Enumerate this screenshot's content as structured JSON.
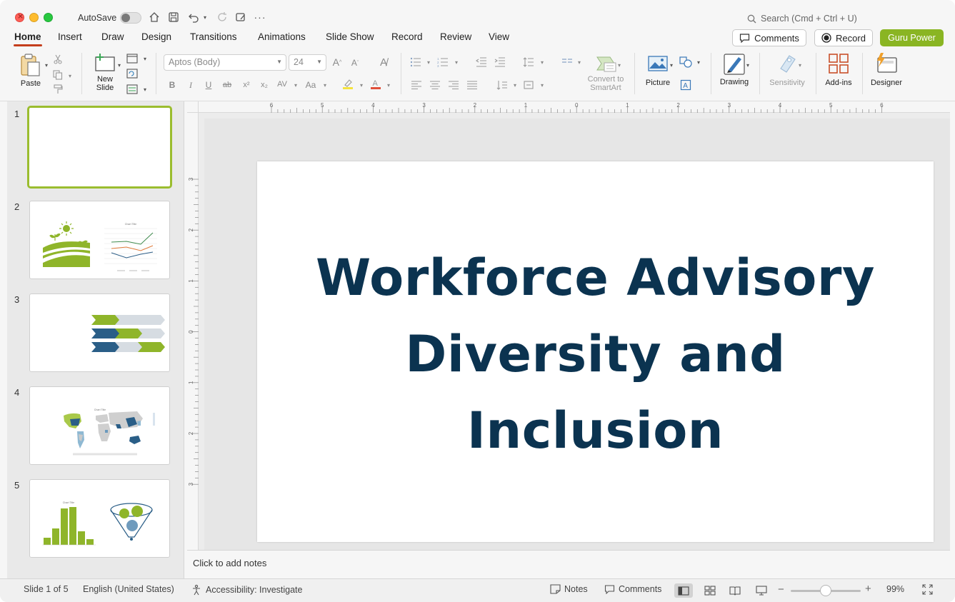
{
  "window": {
    "autosave_label": "AutoSave",
    "autosave_on": false,
    "search_placeholder": "Search (Cmd + Ctrl + U)"
  },
  "tabs": [
    {
      "label": "Home",
      "active": true
    },
    {
      "label": "Insert"
    },
    {
      "label": "Draw"
    },
    {
      "label": "Design"
    },
    {
      "label": "Transitions"
    },
    {
      "label": "Animations"
    },
    {
      "label": "Slide Show"
    },
    {
      "label": "Record"
    },
    {
      "label": "Review"
    },
    {
      "label": "View"
    }
  ],
  "header_buttons": {
    "comments": "Comments",
    "record": "Record",
    "guru": "Guru Power"
  },
  "ribbon": {
    "paste": "Paste",
    "new_slide_line1": "New",
    "new_slide_line2": "Slide",
    "font_name": "Aptos (Body)",
    "font_size": "24",
    "convert_line1": "Convert to",
    "convert_line2": "SmartArt",
    "picture": "Picture",
    "drawing": "Drawing",
    "sensitivity": "Sensitivity",
    "addins": "Add-ins",
    "designer": "Designer"
  },
  "slides": [
    {
      "number": "1",
      "selected": true
    },
    {
      "number": "2",
      "chart_title": "Chart Title"
    },
    {
      "number": "3"
    },
    {
      "number": "4",
      "chart_title": "Chart Title"
    },
    {
      "number": "5",
      "chart_title": "Chart Title"
    }
  ],
  "ruler": {
    "h_ticks": [
      "6",
      "5",
      "4",
      "3",
      "2",
      "1",
      "0",
      "1",
      "2",
      "3",
      "4",
      "5",
      "6"
    ],
    "v_ticks": [
      "3",
      "2",
      "1",
      "0",
      "1",
      "2",
      "3"
    ]
  },
  "slide_main": {
    "title_line1": "Workforce Advisory",
    "title_line2": "Diversity and",
    "title_line3": "Inclusion"
  },
  "notes_placeholder": "Click to add notes",
  "status": {
    "slide_info": "Slide 1 of 5",
    "language": "English (United States)",
    "accessibility": "Accessibility: Investigate",
    "notes": "Notes",
    "comments": "Comments",
    "zoom": "99%"
  },
  "colors": {
    "accent_green": "#8ab523",
    "title_navy": "#0b3350",
    "active_tab_underline": "#c43e1c"
  }
}
